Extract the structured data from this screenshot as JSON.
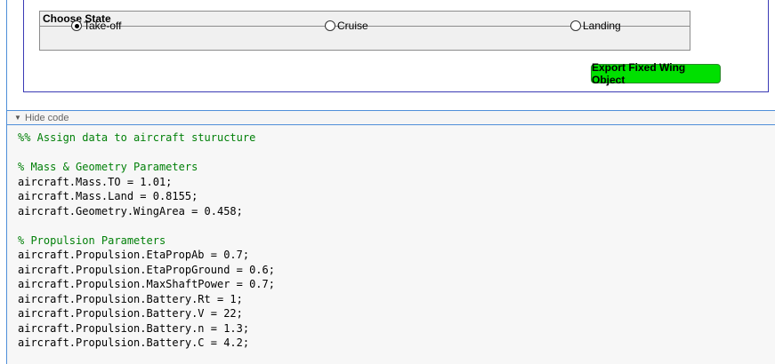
{
  "state_panel": {
    "title": "Choose State",
    "options": [
      {
        "label": "Take-off",
        "selected": true
      },
      {
        "label": "Cruise",
        "selected": false
      },
      {
        "label": "Landing",
        "selected": false
      }
    ]
  },
  "export_button": {
    "label": "Export Fixed Wing Object",
    "color": "#00e000"
  },
  "hide_code": {
    "label": "Hide code",
    "icon": "triangle-down-icon"
  },
  "code": {
    "lines": [
      {
        "text": "%% Assign data to aircraft sturucture",
        "comment": true
      },
      {
        "text": "",
        "comment": false
      },
      {
        "text": "% Mass & Geometry Parameters",
        "comment": true
      },
      {
        "text": "aircraft.Mass.TO = 1.01;",
        "comment": false
      },
      {
        "text": "aircraft.Mass.Land = 0.8155;",
        "comment": false
      },
      {
        "text": "aircraft.Geometry.WingArea = 0.458;",
        "comment": false
      },
      {
        "text": "",
        "comment": false
      },
      {
        "text": "% Propulsion Parameters",
        "comment": true
      },
      {
        "text": "aircraft.Propulsion.EtaPropAb = 0.7;",
        "comment": false
      },
      {
        "text": "aircraft.Propulsion.EtaPropGround = 0.6;",
        "comment": false
      },
      {
        "text": "aircraft.Propulsion.MaxShaftPower = 0.7;",
        "comment": false
      },
      {
        "text": "aircraft.Propulsion.Battery.Rt = 1;",
        "comment": false
      },
      {
        "text": "aircraft.Propulsion.Battery.V = 22;",
        "comment": false
      },
      {
        "text": "aircraft.Propulsion.Battery.n = 1.3;",
        "comment": false
      },
      {
        "text": "aircraft.Propulsion.Battery.C = 4.2;",
        "comment": false
      }
    ],
    "comment_color": "#028009"
  }
}
